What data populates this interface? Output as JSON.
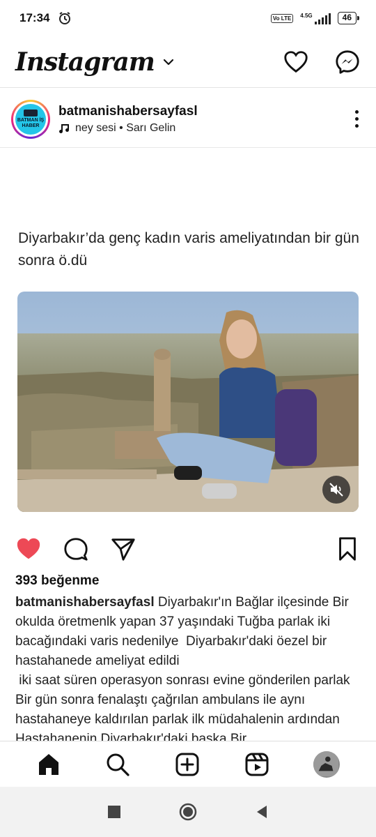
{
  "status_bar": {
    "time": "17:34",
    "network": "4.5G",
    "volte": "Vo LTE",
    "battery": "46"
  },
  "header": {
    "logo": "Instagram"
  },
  "post": {
    "username": "batmanishabersayfasl",
    "audio": "ney sesi • Sarı Gelin",
    "avatar_text": "BATMAN İŞ HABER",
    "headline": "Diyarbakır’da genç kadın varis ameliyatından bir gün sonra ö.dü",
    "likes": "393 beğenme",
    "caption_user": "batmanishabersayfasl",
    "caption_text": "Diyarbakır'ın Bağlar ilçesinde Bir okulda öretmenlk yapan 37 yaşındaki Tuğba parlak iki bacağındaki varis nedenilye  Diyarbakır'daki öezel bir hastahanede ameliyat edildi\n iki saat süren operasyon sonrası evine gönderilen parlak Bir gün sonra fenalaştı çağrılan ambulans ile aynı hastahaneye kaldırılan parlak ilk müdahalenin ardından Hastahanenin Diyarbakır'daki başka Bir"
  },
  "colors": {
    "like_red": "#ed4956",
    "avatar_bg": "#24c5e8"
  },
  "icons": {
    "header": [
      "heart-icon",
      "messenger-icon"
    ],
    "actions": [
      "like-heart-icon",
      "comment-icon",
      "share-icon",
      "bookmark-icon"
    ],
    "nav": [
      "home-icon",
      "search-icon",
      "create-icon",
      "reels-icon",
      "profile-avatar"
    ]
  }
}
